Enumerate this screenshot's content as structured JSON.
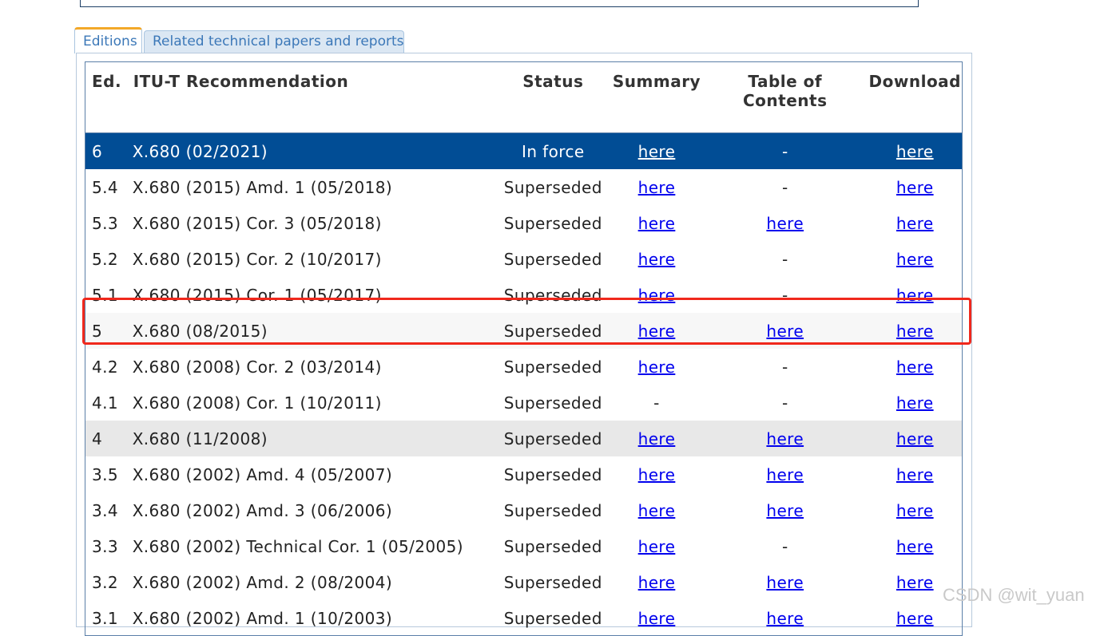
{
  "tabs": [
    {
      "label": "Editions",
      "active": true
    },
    {
      "label": "Related technical papers and reports",
      "active": false
    }
  ],
  "table": {
    "headers": {
      "ed": "Ed.",
      "recommendation": "ITU-T Recommendation",
      "status": "Status",
      "summary": "Summary",
      "toc": "Table of Contents",
      "download": "Download"
    },
    "rows": [
      {
        "ed": "6",
        "rec": "X.680 (02/2021)",
        "status": "In force",
        "summary": "here",
        "toc": "-",
        "download": "here"
      },
      {
        "ed": "5.4",
        "rec": "X.680 (2015) Amd. 1 (05/2018)",
        "status": "Superseded",
        "summary": "here",
        "toc": "-",
        "download": "here"
      },
      {
        "ed": "5.3",
        "rec": "X.680 (2015) Cor. 3 (05/2018)",
        "status": "Superseded",
        "summary": "here",
        "toc": "here",
        "download": "here"
      },
      {
        "ed": "5.2",
        "rec": "X.680 (2015) Cor. 2 (10/2017)",
        "status": "Superseded",
        "summary": "here",
        "toc": "-",
        "download": "here"
      },
      {
        "ed": "5.1",
        "rec": "X.680 (2015) Cor. 1 (05/2017)",
        "status": "Superseded",
        "summary": "here",
        "toc": "-",
        "download": "here"
      },
      {
        "ed": "5",
        "rec": "X.680 (08/2015)",
        "status": "Superseded",
        "summary": "here",
        "toc": "here",
        "download": "here"
      },
      {
        "ed": "4.2",
        "rec": "X.680 (2008) Cor. 2 (03/2014)",
        "status": "Superseded",
        "summary": "here",
        "toc": "-",
        "download": "here"
      },
      {
        "ed": "4.1",
        "rec": "X.680 (2008) Cor. 1 (10/2011)",
        "status": "Superseded",
        "summary": "-",
        "toc": "-",
        "download": "here"
      },
      {
        "ed": "4",
        "rec": "X.680 (11/2008)",
        "status": "Superseded",
        "summary": "here",
        "toc": "here",
        "download": "here"
      },
      {
        "ed": "3.5",
        "rec": "X.680 (2002) Amd. 4 (05/2007)",
        "status": "Superseded",
        "summary": "here",
        "toc": "here",
        "download": "here"
      },
      {
        "ed": "3.4",
        "rec": "X.680 (2002) Amd. 3 (06/2006)",
        "status": "Superseded",
        "summary": "here",
        "toc": "here",
        "download": "here"
      },
      {
        "ed": "3.3",
        "rec": "X.680 (2002) Technical Cor. 1 (05/2005)",
        "status": "Superseded",
        "summary": "here",
        "toc": "-",
        "download": "here"
      },
      {
        "ed": "3.2",
        "rec": "X.680 (2002) Amd. 2 (08/2004)",
        "status": "Superseded",
        "summary": "here",
        "toc": "here",
        "download": "here"
      },
      {
        "ed": "3.1",
        "rec": "X.680 (2002) Amd. 1 (10/2003)",
        "status": "Superseded",
        "summary": "here",
        "toc": "here",
        "download": "here"
      }
    ]
  },
  "watermark": "CSDN @wit_yuan",
  "colors": {
    "current_row_bg": "#014d95",
    "highlight_border": "#f0281c",
    "tab_active_accent": "#f3a829",
    "link": "#0000ee"
  }
}
